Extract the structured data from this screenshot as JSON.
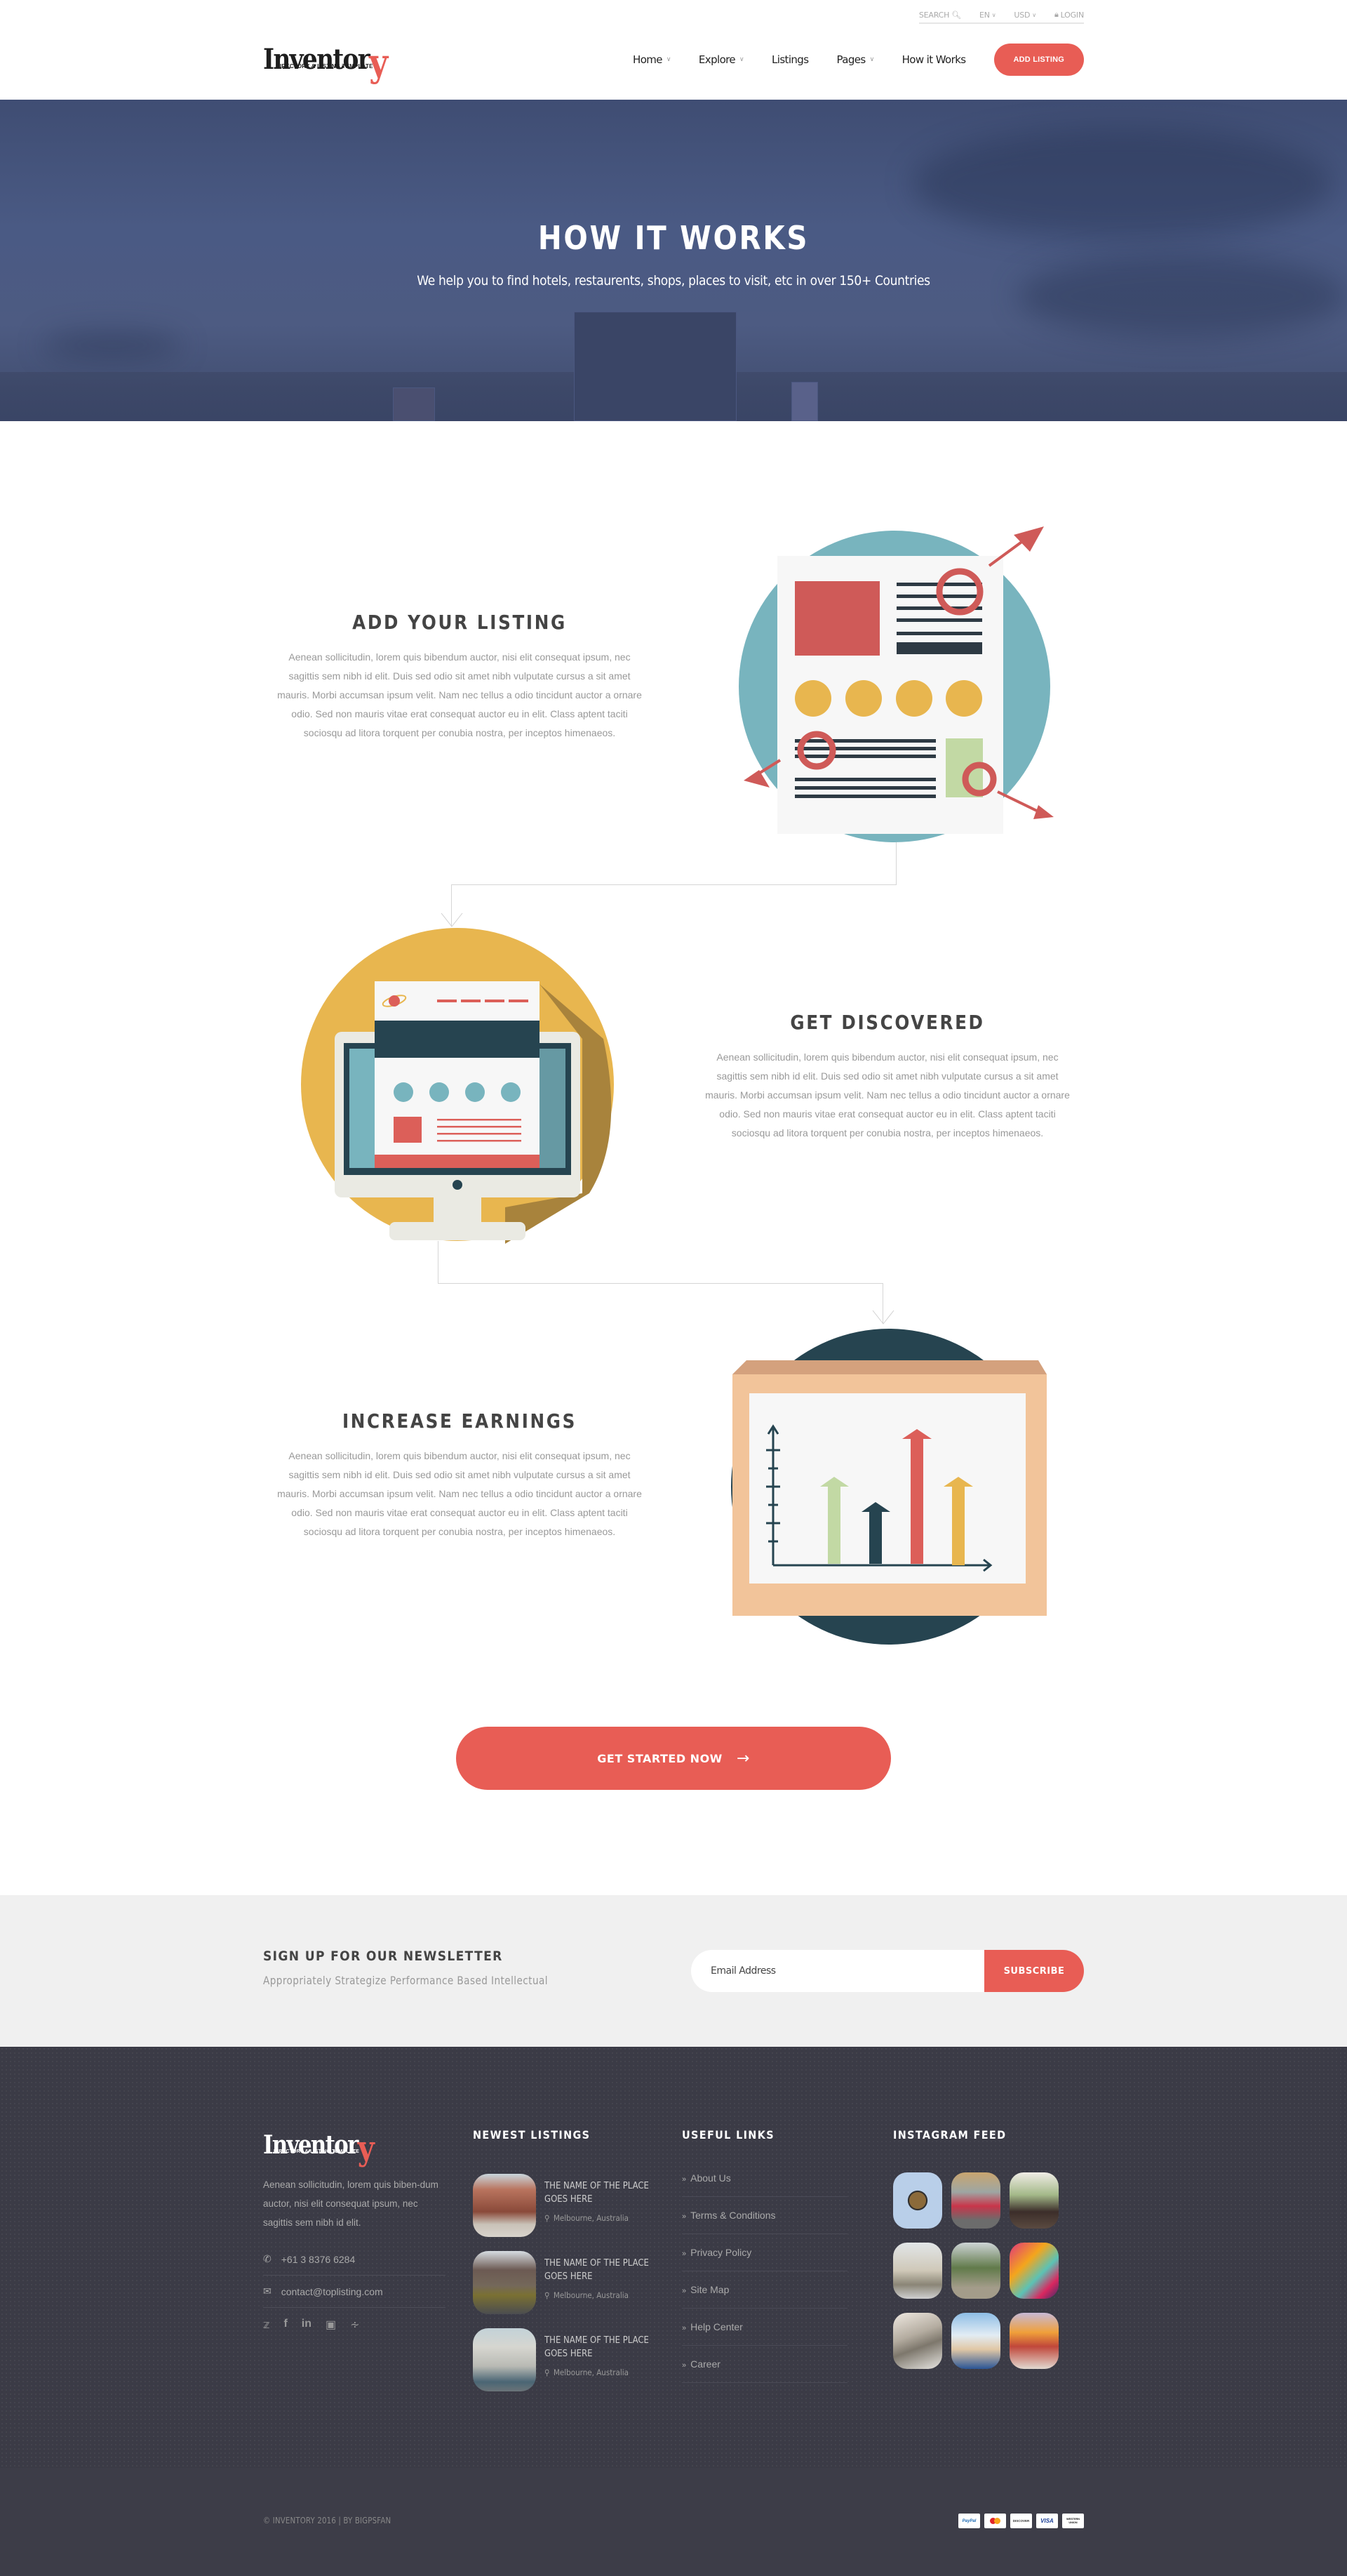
{
  "colors": {
    "accent": "#e85d55",
    "teal": "#78b4be",
    "mustard": "#e8b64f",
    "navy": "#264450",
    "footer_bg": "#3b3b46",
    "newsletter_bg": "#f0f0f0"
  },
  "header": {
    "utility": {
      "search": "SEARCH",
      "language": "EN",
      "currency": "USD",
      "login": "LOGIN"
    },
    "logo": {
      "word": "Inventor",
      "last_letter": "y",
      "tagline": "DIRECTORY & LISTING TEMPLATE"
    },
    "nav": [
      {
        "label": "Home",
        "dropdown": true
      },
      {
        "label": "Explore",
        "dropdown": true
      },
      {
        "label": "Listings",
        "dropdown": false
      },
      {
        "label": "Pages",
        "dropdown": true
      },
      {
        "label": "How it Works",
        "dropdown": false
      }
    ],
    "add_listing": "ADD LISTING"
  },
  "hero": {
    "title": "HOW IT WORKS",
    "subtitle": "We help you to find hotels, restaurents, shops, places to visit, etc in over 150+ Countries"
  },
  "steps": [
    {
      "title": "ADD YOUR LISTING",
      "body": "Aenean sollicitudin, lorem quis bibendum auctor, nisi elit consequat ipsum, nec sagittis sem nibh id elit. Duis sed odio sit amet nibh vulputate cursus a sit amet mauris. Morbi accumsan ipsum velit. Nam nec tellus a odio tincidunt auctor a ornare odio. Sed non  mauris vitae erat consequat auctor eu in elit. Class aptent taciti sociosqu ad litora torquent per conubia nostra, per inceptos himenaeos.",
      "illustration": "document-listing-illustration"
    },
    {
      "title": "GET DISCOVERED",
      "body": "Aenean sollicitudin, lorem quis bibendum auctor, nisi elit consequat ipsum, nec sagittis sem nibh id elit. Duis sed odio sit amet nibh vulputate cursus a sit amet mauris. Morbi accumsan ipsum velit. Nam nec tellus a odio tincidunt auctor a ornare odio. Sed non  mauris vitae erat consequat auctor eu in elit. Class aptent taciti sociosqu ad litora torquent per conubia nostra, per inceptos himenaeos.",
      "illustration": "monitor-website-illustration"
    },
    {
      "title": "INCREASE EARNINGS",
      "body": "Aenean sollicitudin, lorem quis bibendum auctor, nisi elit consequat ipsum, nec sagittis sem nibh id elit. Duis sed odio sit amet nibh vulputate cursus a sit amet mauris. Morbi accumsan ipsum velit. Nam nec tellus a odio tincidunt auctor a ornare odio. Sed non  mauris vitae erat consequat auctor eu in elit. Class aptent taciti sociosqu ad litora torquent per conubia nostra, per inceptos himenaeos.",
      "illustration": "growth-chart-illustration"
    }
  ],
  "cta": {
    "label": "GET STARTED NOW",
    "icon": "arrow-right-icon"
  },
  "newsletter": {
    "title": "SIGN UP FOR OUR NEWSLETTER",
    "subtitle": "Appropriately Strategize Performance Based Intellectual",
    "email_placeholder": "Email Address",
    "email_value": "",
    "button": "SUBSCRIBE"
  },
  "footer": {
    "about": "Aenean sollicitudin, lorem quis biben-dum auctor, nisi elit consequat ipsum, nec sagittis sem nibh id elit.",
    "phone": "+61 3 8376 6284",
    "email": "contact@toplisting.com",
    "social": [
      "twitter-icon",
      "facebook-icon",
      "linkedin-icon",
      "instagram-icon",
      "rss-icon"
    ],
    "newest_listings": {
      "heading": "NEWEST LISTINGS",
      "items": [
        {
          "name": "THE NAME OF THE PLACE GOES HERE",
          "location": "Melbourne, Australia"
        },
        {
          "name": "THE NAME OF THE PLACE GOES HERE",
          "location": "Melbourne, Australia"
        },
        {
          "name": "THE NAME OF THE PLACE GOES HERE",
          "location": "Melbourne, Australia"
        }
      ]
    },
    "useful_links": {
      "heading": "USEFUL LINKS",
      "items": [
        "About Us",
        "Terms & Conditions",
        "Privacy Policy",
        "Site Map",
        "Help Center",
        "Career"
      ]
    },
    "instagram": {
      "heading": "INSTAGRAM FEED",
      "photos": [
        "latte",
        "red-beetle-car",
        "cafe-patron",
        "st-pauls-cathedral",
        "park-lake",
        "graffiti-face",
        "pillows",
        "castle",
        "cocktails"
      ]
    },
    "copyright": "© INVENTORY 2016  |  BY BIGPSFAN",
    "payments": [
      "PayPal",
      "MasterCard",
      "DISCOVER",
      "VISA",
      "WESTERN UNION"
    ]
  }
}
